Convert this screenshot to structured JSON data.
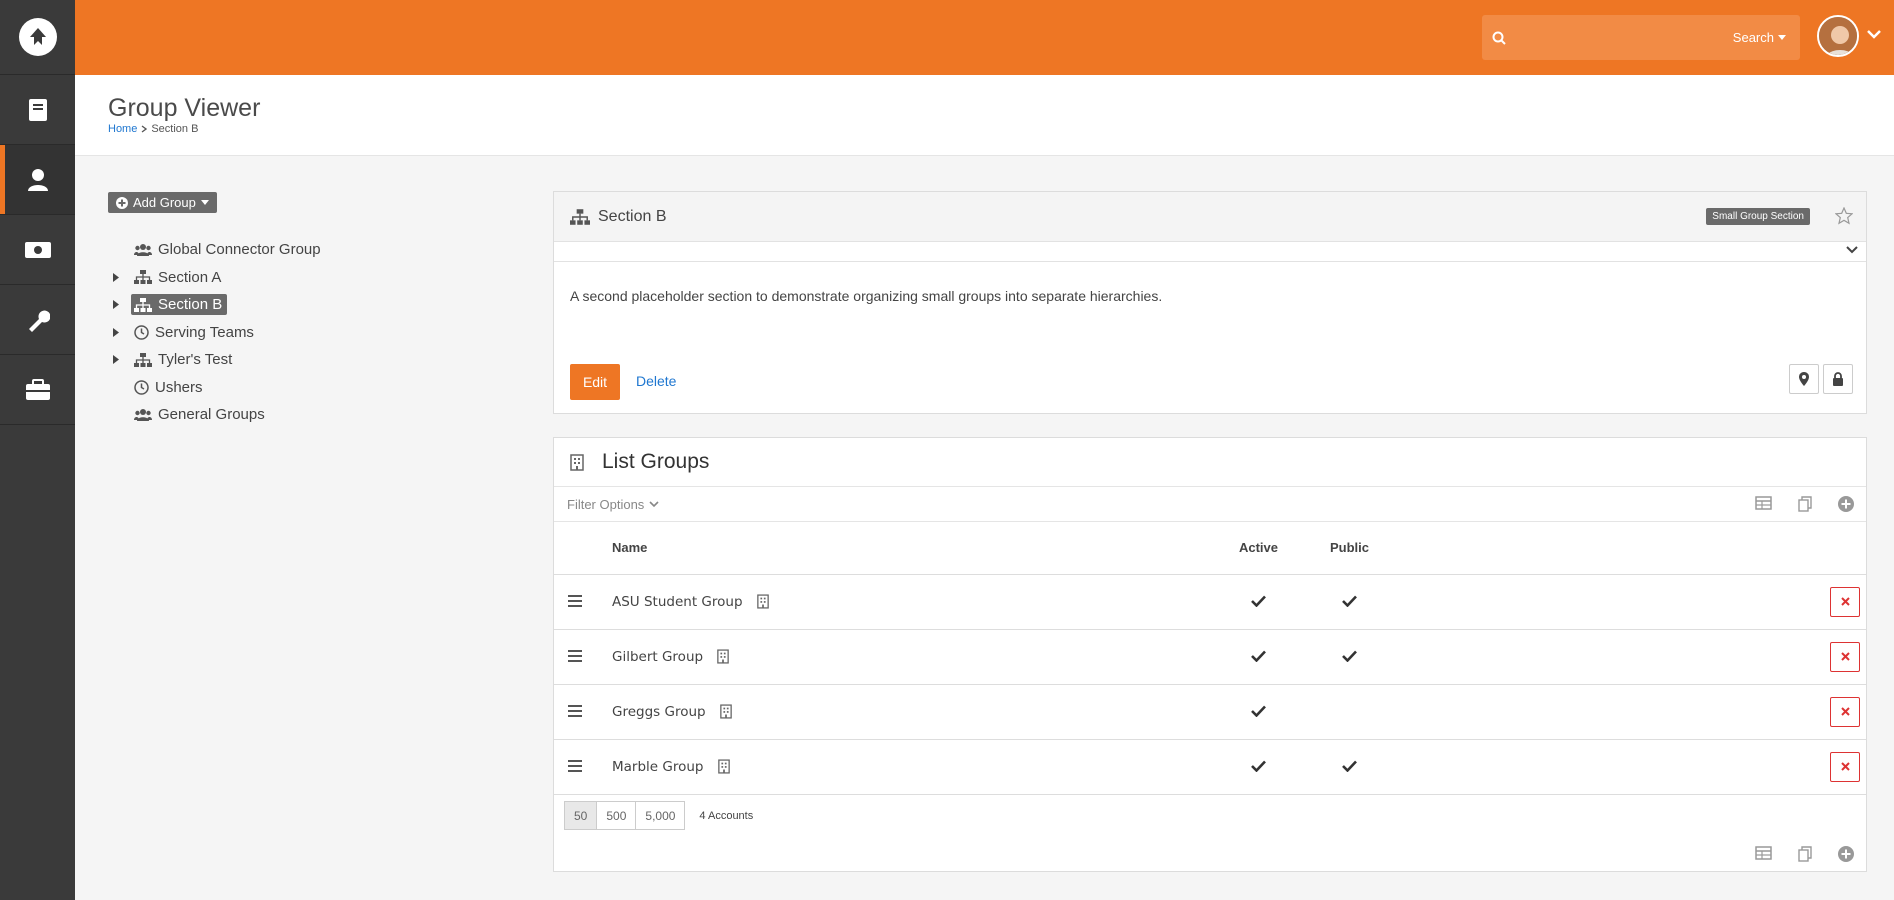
{
  "colors": {
    "brand": "#ee7624",
    "sidebar": "#3a3a3a",
    "link": "#1f77d0",
    "danger": "#dd3333"
  },
  "sidebar": {
    "logo_icon": "rock-logo-icon",
    "items": [
      {
        "icon": "book-icon"
      },
      {
        "icon": "user-icon",
        "active": true
      },
      {
        "icon": "money-icon"
      },
      {
        "icon": "wrench-icon"
      },
      {
        "icon": "briefcase-icon"
      }
    ]
  },
  "topbar": {
    "search": {
      "placeholder": "",
      "button_label": "Search"
    }
  },
  "page": {
    "title": "Group Viewer",
    "breadcrumb": {
      "home": "Home",
      "current": "Section B"
    }
  },
  "tree": {
    "add_group_label": "Add Group",
    "items": [
      {
        "label": "Global Connector Group",
        "icon": "users-icon",
        "expandable": false
      },
      {
        "label": "Section A",
        "icon": "sitemap-icon",
        "expandable": true
      },
      {
        "label": "Section B",
        "icon": "sitemap-icon",
        "expandable": true,
        "selected": true
      },
      {
        "label": "Serving Teams",
        "icon": "clock-icon",
        "expandable": true
      },
      {
        "label": "Tyler's Test",
        "icon": "sitemap-icon",
        "expandable": true
      },
      {
        "label": "Ushers",
        "icon": "clock-icon",
        "expandable": false
      },
      {
        "label": "General Groups",
        "icon": "users-icon",
        "expandable": false
      }
    ]
  },
  "detail": {
    "title": "Section B",
    "type_badge": "Small Group Section",
    "description": "A second placeholder section to demonstrate organizing small groups into separate hierarchies.",
    "edit_label": "Edit",
    "delete_label": "Delete"
  },
  "list": {
    "title": "List Groups",
    "filter_label": "Filter Options",
    "columns": {
      "name": "Name",
      "active": "Active",
      "public": "Public"
    },
    "rows": [
      {
        "name": "ASU Student Group",
        "active": true,
        "public": true
      },
      {
        "name": "Gilbert Group",
        "active": true,
        "public": true
      },
      {
        "name": "Greggs Group",
        "active": true,
        "public": false
      },
      {
        "name": "Marble Group",
        "active": true,
        "public": true
      }
    ],
    "page_sizes": [
      "50",
      "500",
      "5,000"
    ],
    "count_label": "4 Accounts"
  }
}
